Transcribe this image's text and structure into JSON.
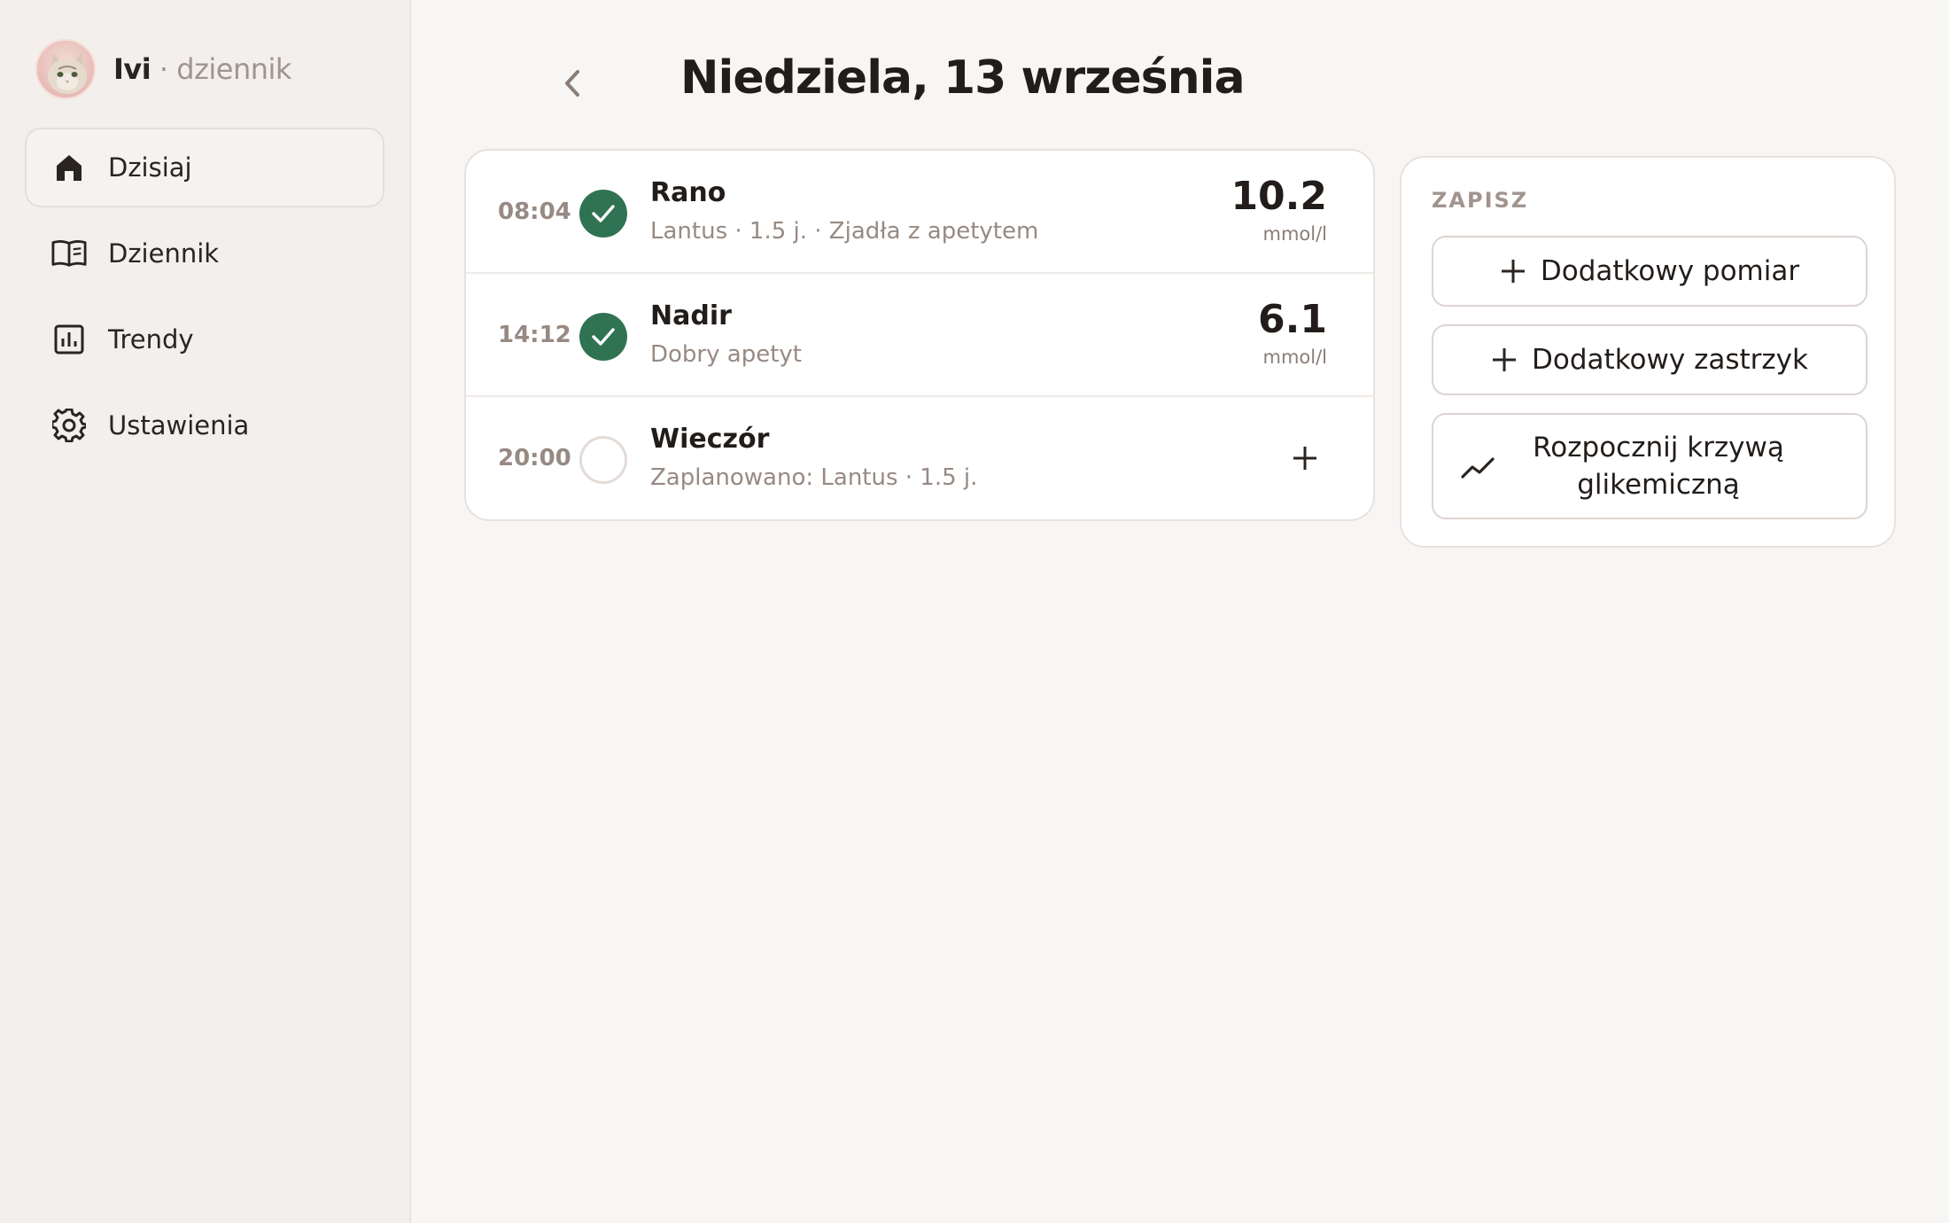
{
  "sidebar": {
    "brand_name": "Ivi",
    "brand_sep": " · ",
    "brand_sub": "dziennik",
    "items": [
      {
        "label": "Dzisiaj",
        "icon": "home-icon",
        "active": true
      },
      {
        "label": "Dziennik",
        "icon": "book-icon",
        "active": false
      },
      {
        "label": "Trendy",
        "icon": "bar-chart-icon",
        "active": false
      },
      {
        "label": "Ustawienia",
        "icon": "gear-icon",
        "active": false
      }
    ]
  },
  "header": {
    "title": "Niedziela, 13 września"
  },
  "entries": [
    {
      "time": "08:04",
      "status": "done",
      "title": "Rano",
      "subtitle": "Lantus · 1.5 j. · Zjadła z apetytem",
      "value": "10.2",
      "unit": "mmol/l"
    },
    {
      "time": "14:12",
      "status": "done",
      "title": "Nadir",
      "subtitle": "Dobry apetyt",
      "value": "6.1",
      "unit": "mmol/l"
    },
    {
      "time": "20:00",
      "status": "pending",
      "title": "Wieczór",
      "subtitle": "Zaplanowano: Lantus · 1.5 j."
    }
  ],
  "save": {
    "heading": "ZAPISZ",
    "btn_measurement": "Dodatkowy pomiar",
    "btn_injection": "Dodatkowy zastrzyk",
    "btn_curve_line1": "Rozpocznij krzywą",
    "btn_curve_line2": "glikemiczną"
  },
  "colors": {
    "accent_green": "#2f7353",
    "background": "#f8f6f4",
    "sidebar": "#f3efec",
    "muted_text": "#978a83"
  }
}
